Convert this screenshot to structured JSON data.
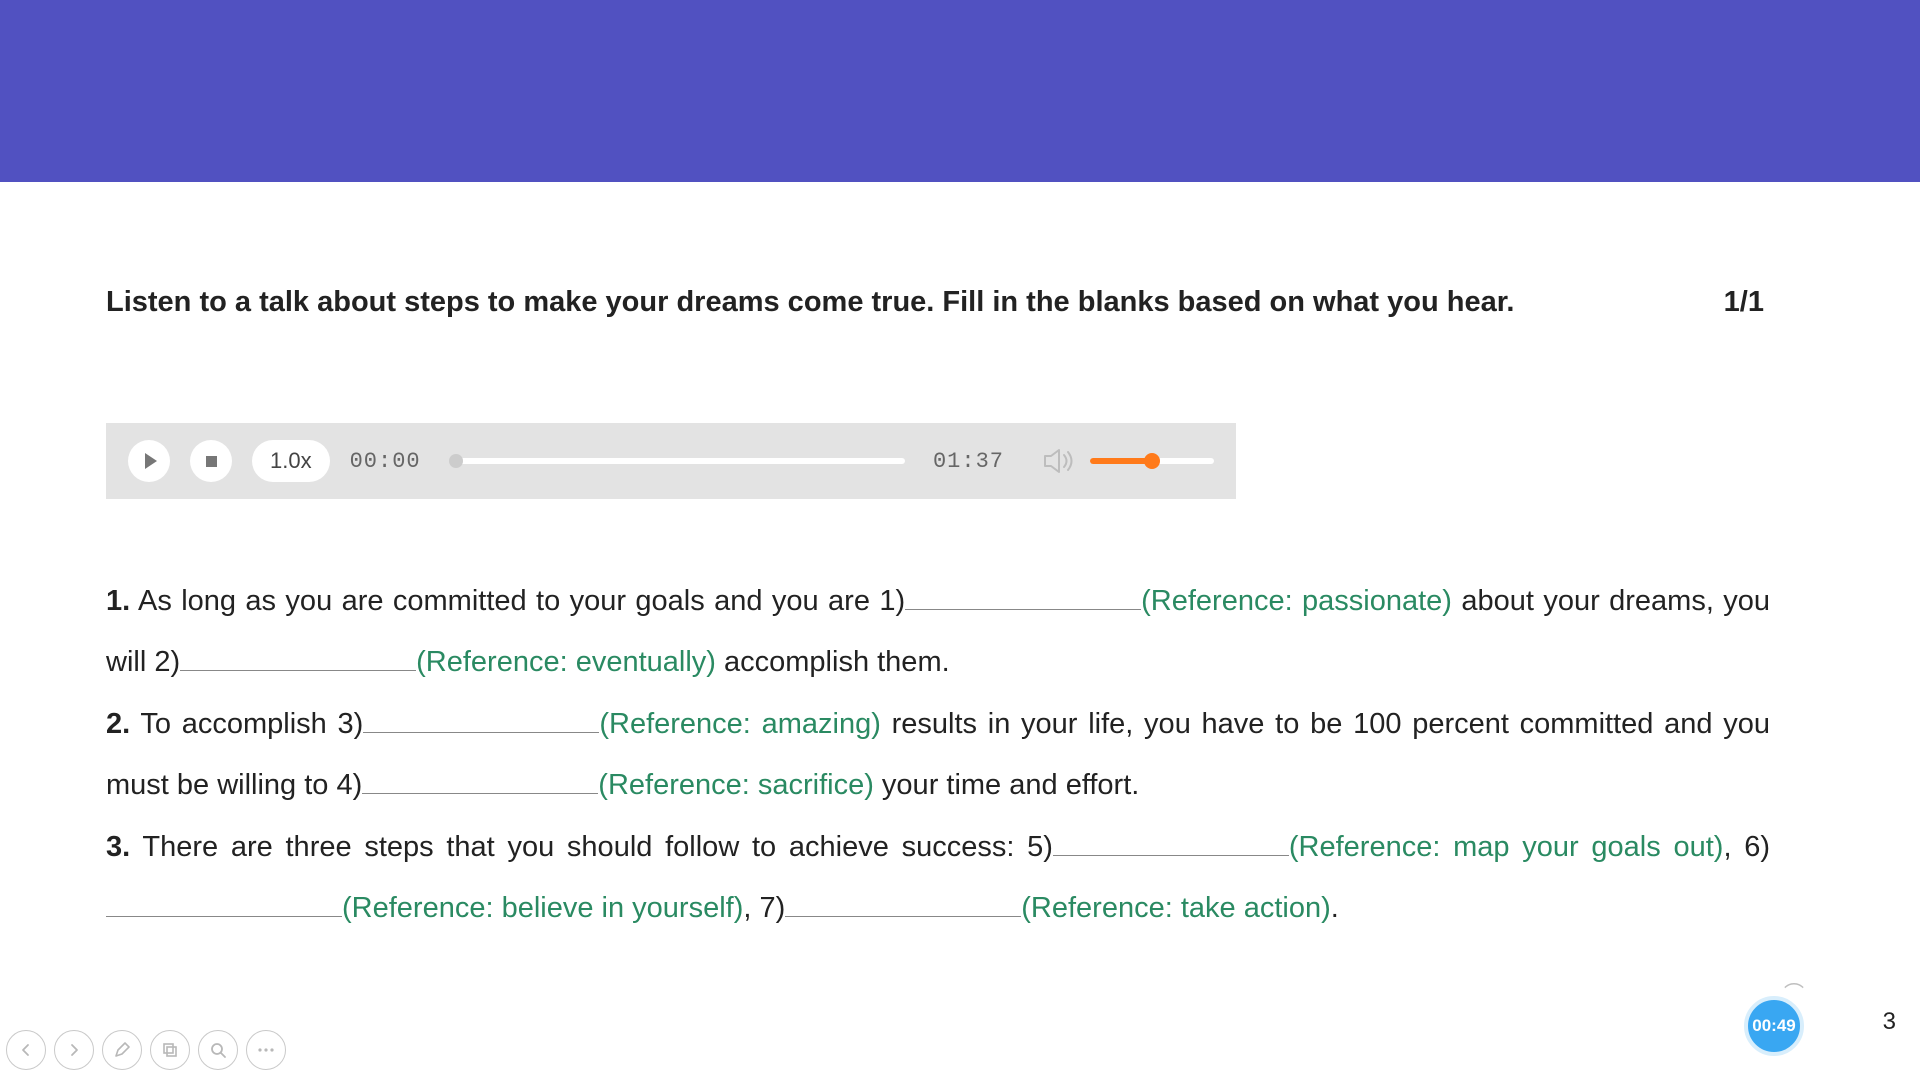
{
  "instruction": "Listen to a talk about steps to make your dreams come true. Fill in the blanks based on what you hear.",
  "progress_counter": "1/1",
  "player": {
    "speed": "1.0x",
    "current": "00:00",
    "total": "01:37"
  },
  "passage": {
    "q1_num": "1.",
    "q1_a": " As long as you are committed to your goals and you are 1)",
    "ref1": "(Reference: passionate)",
    "q1_b": " about your dreams, you will 2)",
    "ref2": "(Reference: eventually)",
    "q1_c": " accomplish them.",
    "q2_num": "2.",
    "q2_a": " To accomplish 3)",
    "ref3": "(Reference: amazing)",
    "q2_b": " results in your life, you have to be 100 percent committed and you must be willing to 4)",
    "ref4": "(Reference: sacrifice)",
    "q2_c": " your time and effort.",
    "q3_num": "3.",
    "q3_a": " There are three steps that you should follow to achieve success: 5)",
    "ref5": "(Reference: map your goals out)",
    "sep56": ", 6)",
    "ref6": "(Reference: believe in yourself)",
    "sep67": ", 7)",
    "ref7": "(Reference: take action)",
    "end": "."
  },
  "timer": "00:49",
  "page_number": "3"
}
